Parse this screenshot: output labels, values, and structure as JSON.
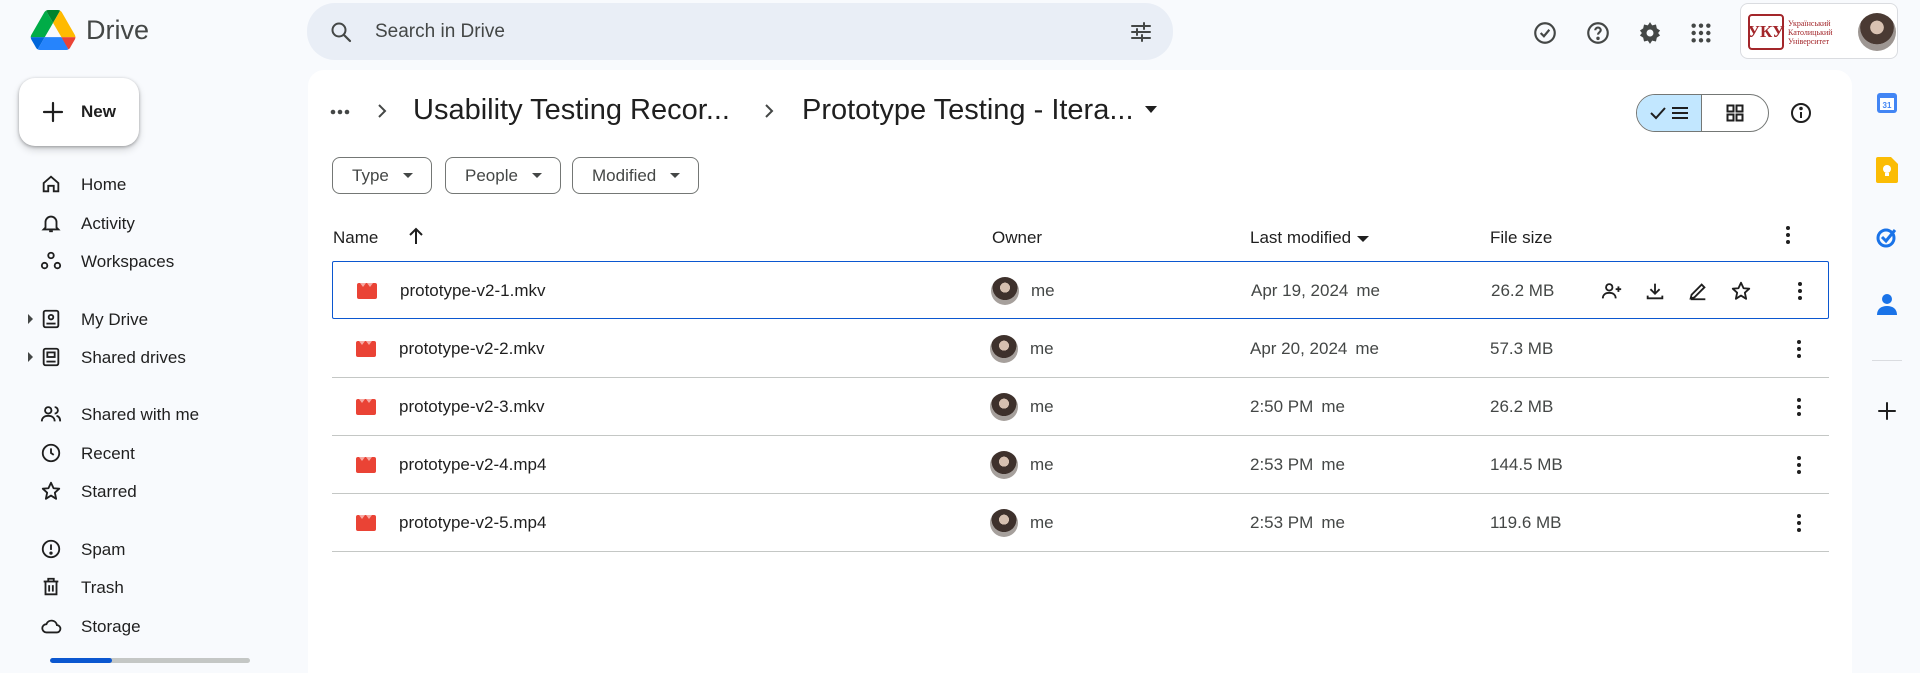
{
  "app": {
    "name": "Drive"
  },
  "search": {
    "placeholder": "Search in Drive"
  },
  "account": {
    "org_name": "Український Католицький Університет",
    "org_mark": "УКУ"
  },
  "sidebar": {
    "new_label": "New",
    "items": [
      {
        "label": "Home",
        "icon": "home-icon"
      },
      {
        "label": "Activity",
        "icon": "bell-icon"
      },
      {
        "label": "Workspaces",
        "icon": "workspaces-icon"
      },
      {
        "label": "My Drive",
        "icon": "my-drive-icon"
      },
      {
        "label": "Shared drives",
        "icon": "shared-drives-icon"
      },
      {
        "label": "Shared with me",
        "icon": "people-icon"
      },
      {
        "label": "Recent",
        "icon": "clock-icon"
      },
      {
        "label": "Starred",
        "icon": "star-icon"
      },
      {
        "label": "Spam",
        "icon": "spam-icon"
      },
      {
        "label": "Trash",
        "icon": "trash-icon"
      },
      {
        "label": "Storage",
        "icon": "cloud-icon"
      }
    ],
    "storage_used_fraction": 0.31
  },
  "breadcrumb": {
    "parent": "Usability Testing Recor...",
    "current": "Prototype Testing - Itera..."
  },
  "filters": {
    "type": "Type",
    "people": "People",
    "modified": "Modified"
  },
  "table": {
    "headers": {
      "name": "Name",
      "owner": "Owner",
      "modified": "Last modified",
      "size": "File size"
    },
    "rows": [
      {
        "name": "prototype-v2-1.mkv",
        "owner": "me",
        "modified": "Apr 19, 2024",
        "modified_by": "me",
        "size": "26.2 MB"
      },
      {
        "name": "prototype-v2-2.mkv",
        "owner": "me",
        "modified": "Apr 20, 2024",
        "modified_by": "me",
        "size": "57.3 MB"
      },
      {
        "name": "prototype-v2-3.mkv",
        "owner": "me",
        "modified": "2:50 PM",
        "modified_by": "me",
        "size": "26.2 MB"
      },
      {
        "name": "prototype-v2-4.mp4",
        "owner": "me",
        "modified": "2:53 PM",
        "modified_by": "me",
        "size": "144.5 MB"
      },
      {
        "name": "prototype-v2-5.mp4",
        "owner": "me",
        "modified": "2:53 PM",
        "modified_by": "me",
        "size": "119.6 MB"
      }
    ]
  },
  "colors": {
    "accent": "#0b57d0",
    "selected_view": "#c2e7ff",
    "video_icon": "#ea4335",
    "background": "#f8fafd"
  }
}
